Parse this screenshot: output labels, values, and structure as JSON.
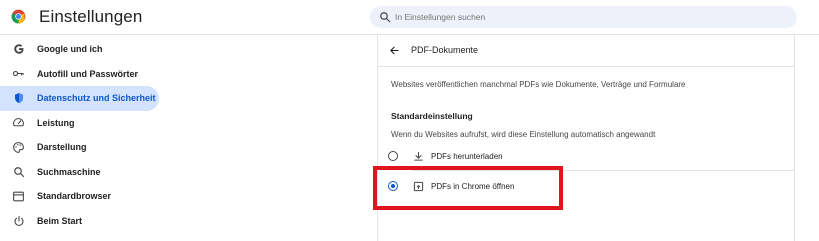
{
  "header": {
    "title": "Einstellungen",
    "search": {
      "placeholder": "In Einstellungen suchen"
    }
  },
  "sidebar": {
    "items": [
      {
        "label": "Google und ich",
        "icon": "google-g-icon"
      },
      {
        "label": "Autofill und Passwörter",
        "icon": "key-icon"
      },
      {
        "label": "Datenschutz und Sicherheit",
        "icon": "shield-icon",
        "active": true
      },
      {
        "label": "Leistung",
        "icon": "speedometer-icon"
      },
      {
        "label": "Darstellung",
        "icon": "palette-icon"
      },
      {
        "label": "Suchmaschine",
        "icon": "search-icon"
      },
      {
        "label": "Standardbrowser",
        "icon": "browser-icon"
      },
      {
        "label": "Beim Start",
        "icon": "power-icon"
      }
    ]
  },
  "content": {
    "title": "PDF-Dokumente",
    "description": "Websites veröffentlichen manchmal PDFs wie Dokumente, Verträge und Formulare",
    "section_title": "Standardeinstellung",
    "section_description": "Wenn du Websites aufrufst, wird diese Einstellung automatisch angewandt",
    "options": [
      {
        "label": "PDFs herunterladen",
        "icon": "download-icon",
        "checked": false
      },
      {
        "label": "PDFs in Chrome öffnen",
        "icon": "open-in-browser-icon",
        "checked": true
      }
    ]
  },
  "colors": {
    "accent": "#0b57d0",
    "active_nav_bg": "#d3e3fd",
    "highlight": "#e0141e"
  }
}
